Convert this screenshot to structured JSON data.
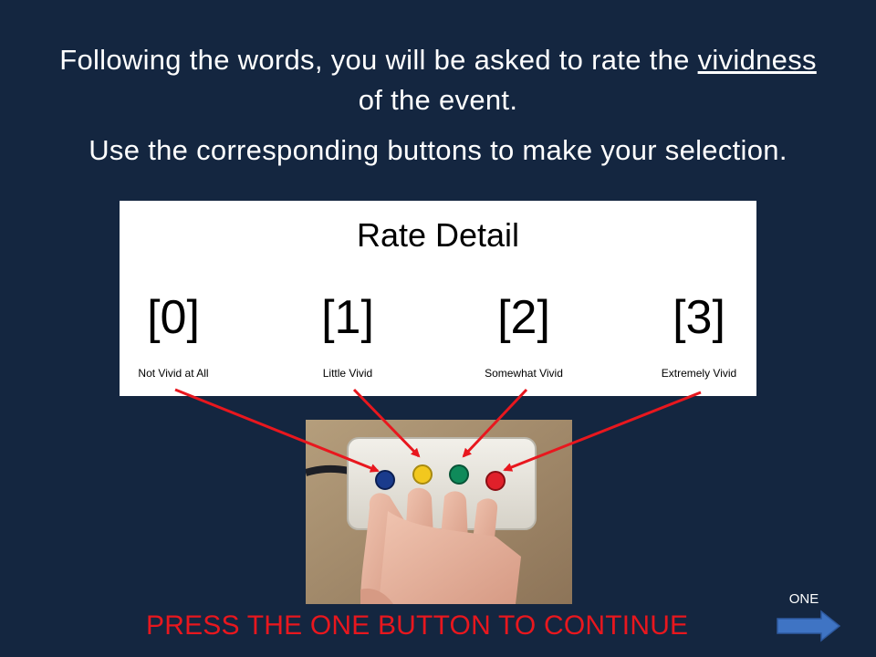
{
  "instructions": {
    "line1_prefix": "Following the words, you will be asked to rate the",
    "line1_emphasis": "vividness",
    "line2": "of the event.",
    "line3": "Use the corresponding buttons to make your selection."
  },
  "rating_panel": {
    "title": "Rate Detail",
    "options": [
      {
        "key": "[0]",
        "label": "Not Vivid at All",
        "button_color": "#1a3b8c"
      },
      {
        "key": "[1]",
        "label": "Little Vivid",
        "button_color": "#f2c81e"
      },
      {
        "key": "[2]",
        "label": "Somewhat Vivid",
        "button_color": "#0f8a5a"
      },
      {
        "key": "[3]",
        "label": "Extremely Vivid",
        "button_color": "#e0202a"
      }
    ]
  },
  "prompt": {
    "text": "PRESS THE ONE BUTTON TO CONTINUE",
    "color": "#e8171e"
  },
  "nav": {
    "label": "ONE",
    "icon": "right-arrow-icon"
  },
  "colors": {
    "background": "#142640",
    "arrow": "#e8171e",
    "nav_arrow": "#3f74c4"
  }
}
